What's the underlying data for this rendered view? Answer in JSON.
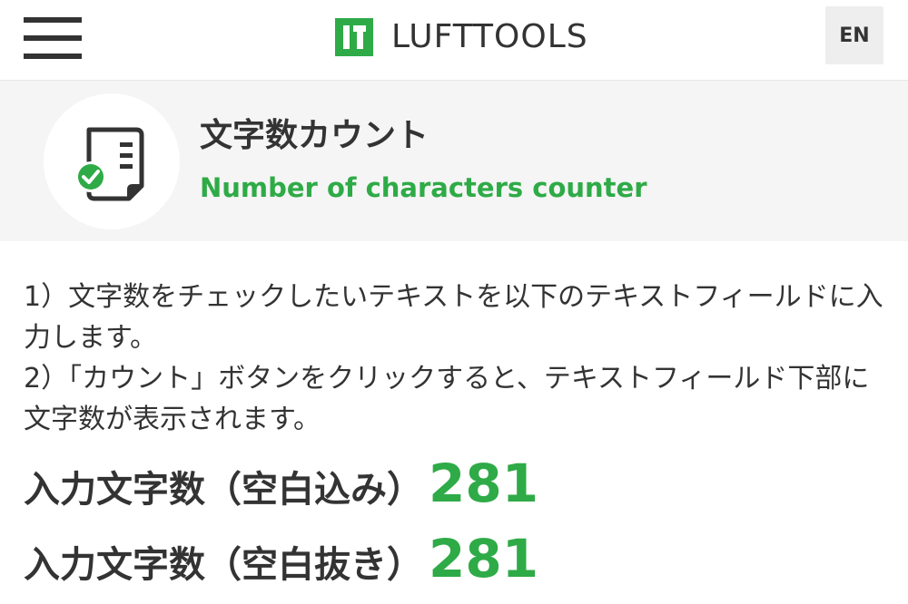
{
  "header": {
    "menu_icon": "hamburger-menu-icon",
    "logo_text": "LUFTTOOLS",
    "lang_button": "EN"
  },
  "tool": {
    "icon": "document-check-icon",
    "title": "文字数カウント",
    "subtitle": "Number of characters counter"
  },
  "instructions": {
    "step1": "1）文字数をチェックしたいテキストを以下のテキストフィールドに入力します。",
    "step2": "2）「カウント」ボタンをクリックすると、テキストフィールド下部に文字数が表示されます。"
  },
  "counts": {
    "with_spaces_label": "入力文字数（空白込み）",
    "with_spaces_value": "281",
    "without_spaces_label": "入力文字数（空白抜き）",
    "without_spaces_value": "281"
  },
  "colors": {
    "accent": "#2eaa46",
    "text": "#333333",
    "hero_bg": "#f5f5f5"
  }
}
